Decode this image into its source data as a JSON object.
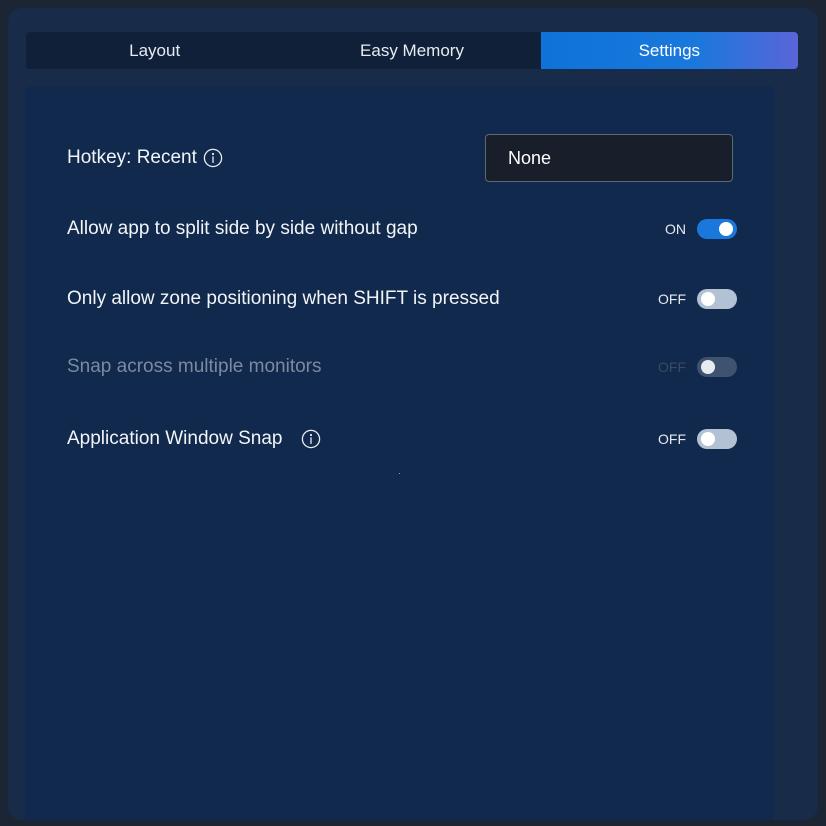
{
  "tabs": [
    {
      "label": "Layout",
      "active": false
    },
    {
      "label": "Easy Memory",
      "active": false
    },
    {
      "label": "Settings",
      "active": true
    }
  ],
  "settings": {
    "hotkey": {
      "label": "Hotkey: Recent",
      "value": "None",
      "icon": "info-icon"
    },
    "split_without_gap": {
      "label": "Allow app to split side by side without gap",
      "state": "ON"
    },
    "shift_positioning": {
      "label": "Only allow zone positioning when SHIFT is pressed",
      "state": "OFF"
    },
    "snap_monitors": {
      "label": "Snap across multiple monitors",
      "state": "OFF",
      "disabled": true
    },
    "window_snap": {
      "label": "Application Window Snap",
      "state": "OFF",
      "icon": "info-icon"
    }
  },
  "colors": {
    "accent": "#1a78dc",
    "panel": "#10294c",
    "window": "#182b48"
  }
}
